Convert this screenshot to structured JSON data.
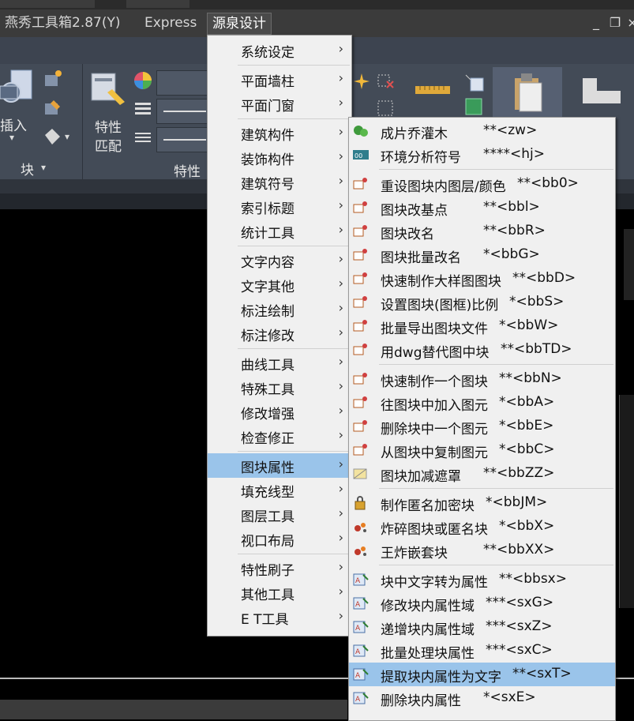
{
  "menubar": {
    "items": [
      {
        "label": "燕秀工具箱2.87(Y)"
      },
      {
        "label": "Express"
      },
      {
        "label": "源泉设计"
      }
    ],
    "window_controls": [
      "minimize-icon",
      "restore-icon",
      "close-icon"
    ]
  },
  "ribbon": {
    "insert_label": "插入",
    "block_label": "块",
    "match_label_1": "特性",
    "match_label_2": "匹配",
    "properties_label": "特性"
  },
  "main_menu": {
    "title": "源泉设计",
    "groups": [
      [
        "系统设定"
      ],
      [
        "平面墙柱",
        "平面门窗"
      ],
      [
        "建筑构件",
        "装饰构件",
        "建筑符号",
        "索引标题",
        "统计工具"
      ],
      [
        "文字内容",
        "文字其他",
        "标注绘制",
        "标注修改"
      ],
      [
        "曲线工具",
        "特殊工具",
        "修改增强",
        "检查修正"
      ],
      [
        "图块属性",
        "填充线型",
        "图层工具",
        "视口布局"
      ],
      [
        "特性刷子",
        "其他工具",
        "E T工具"
      ]
    ],
    "highlighted": "图块属性"
  },
  "submenu": {
    "groups": [
      [
        {
          "label": "成片乔灌木",
          "cmd": "**<zw>",
          "icon": "tree-icon"
        },
        {
          "label": "环境分析符号",
          "cmd": "****<hj>",
          "icon": "analysis-symbol-icon"
        }
      ],
      [
        {
          "label": "重设图块内图层/颜色",
          "cmd": "**<bb0>",
          "icon": "block-layer-icon"
        },
        {
          "label": "图块改基点",
          "cmd": "**<bbl>",
          "icon": "block-basepoint-icon"
        },
        {
          "label": "图块改名",
          "cmd": "**<bbR>",
          "icon": "block-rename-icon"
        },
        {
          "label": "图块批量改名",
          "cmd": "*<bbG>",
          "icon": "block-batch-rename-icon"
        },
        {
          "label": "快速制作大样图图块",
          "cmd": "**<bbD>",
          "icon": "detail-block-icon"
        },
        {
          "label": "设置图块(图框)比例",
          "cmd": "*<bbS>",
          "icon": "block-scale-icon"
        },
        {
          "label": "批量导出图块文件",
          "cmd": "*<bbW>",
          "icon": "block-export-icon"
        },
        {
          "label": "用dwg替代图中块",
          "cmd": "**<bbTD>",
          "icon": "dwg-replace-icon"
        }
      ],
      [
        {
          "label": "快速制作一个图块",
          "cmd": "**<bbN>",
          "icon": "make-block-icon"
        },
        {
          "label": "往图块中加入图元",
          "cmd": "*<bbA>",
          "icon": "add-entity-icon"
        },
        {
          "label": "删除块中一个图元",
          "cmd": "*<bbE>",
          "icon": "delete-entity-icon"
        },
        {
          "label": "从图块中复制图元",
          "cmd": "*<bbC>",
          "icon": "copy-entity-icon"
        },
        {
          "label": "图块加减遮罩",
          "cmd": "**<bbZZ>",
          "icon": "mask-icon"
        }
      ],
      [
        {
          "label": "制作匿名加密块",
          "cmd": "*<bbJM>",
          "icon": "lock-block-icon"
        },
        {
          "label": "炸碎图块或匿名块",
          "cmd": "*<bbX>",
          "icon": "explode-block-icon"
        },
        {
          "label": "王炸嵌套块",
          "cmd": "**<bbXX>",
          "icon": "explode-nested-icon"
        }
      ],
      [
        {
          "label": "块中文字转为属性",
          "cmd": "**<bbsx>",
          "icon": "text-to-attr-icon"
        },
        {
          "label": "修改块内属性域",
          "cmd": "***<sxG>",
          "icon": "edit-attr-icon"
        },
        {
          "label": "递增块内属性域",
          "cmd": "***<sxZ>",
          "icon": "increment-attr-icon"
        },
        {
          "label": "批量处理块属性",
          "cmd": "***<sxC>",
          "icon": "batch-attr-icon"
        },
        {
          "label": "提取块内属性为文字",
          "cmd": "**<sxT>",
          "icon": "extract-attr-icon"
        },
        {
          "label": "删除块内属性",
          "cmd": "*<sxE>",
          "icon": "delete-attr-icon"
        }
      ]
    ],
    "highlighted": "提取块内属性为文字"
  },
  "colors": {
    "menu_bg": "#f0f0f0",
    "highlight": "#9ac4ea",
    "ribbon_bg": "#434b57",
    "menubar_bg": "#3b3b3b"
  }
}
